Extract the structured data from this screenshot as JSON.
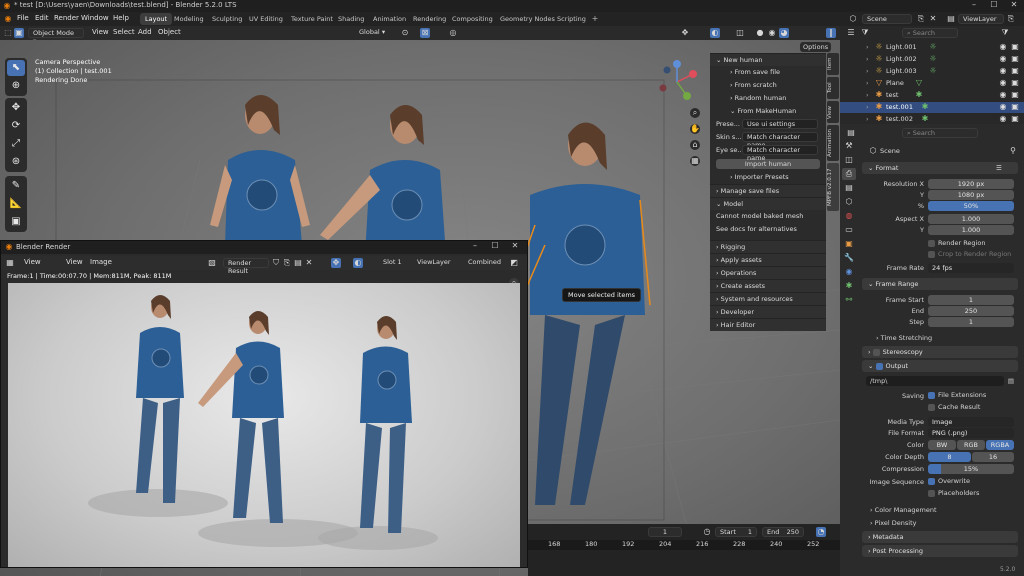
{
  "window": {
    "title": "* test [D:\\Users\\yaen\\Downloads\\test.blend] - Blender 5.2.0 LTS"
  },
  "menu": [
    "File",
    "Edit",
    "Render",
    "Window",
    "Help"
  ],
  "workspaces": [
    "Layout",
    "Modeling",
    "Sculpting",
    "UV Editing",
    "Texture Paint",
    "Shading",
    "Animation",
    "Rendering",
    "Compositing",
    "Geometry Nodes",
    "Scripting"
  ],
  "scene": {
    "label": "Scene",
    "view_layer": "ViewLayer"
  },
  "viewport_header": {
    "mode": "Object Mode",
    "menus": [
      "View",
      "Select",
      "Add",
      "Object"
    ],
    "orientation": "Global",
    "options": "Options"
  },
  "viewport_overlay": {
    "line1": "Camera Perspective",
    "line2": "(1) Collection | test.001",
    "line3": "Rendering Done"
  },
  "tooltip": "Move selected items",
  "npanel": {
    "new_human": "New human",
    "from_save": "From save file",
    "from_scratch": "From scratch",
    "random_human": "Random human",
    "from_makehuman": "From MakeHuman",
    "preset_label": "Prese...",
    "preset_value": "Use ui settings",
    "skin_label": "Skin s...",
    "skin_value": "Match character name",
    "eye_label": "Eye se...",
    "eye_value": "Match character name",
    "import_human": "Import human",
    "importer_presets": "Importer Presets",
    "manage_save": "Manage save files",
    "model": "Model",
    "model_note1": "Cannot model baked mesh",
    "model_note2": "See docs for alternatives",
    "rigging": "Rigging",
    "apply_assets": "Apply assets",
    "operations": "Operations",
    "create_assets": "Create assets",
    "system_resources": "System and resources",
    "developer": "Developer",
    "hair_editor": "Hair Editor"
  },
  "ntabs": [
    "Item",
    "Tool",
    "View",
    "Animation",
    "MPFB v2.0.17"
  ],
  "render_window": {
    "title": "Blender Render",
    "menus": [
      "View",
      "View",
      "Image"
    ],
    "image_name": "Render Result",
    "slot": "Slot 1",
    "view_layer": "ViewLayer",
    "pass": "Combined",
    "stats": "Frame:1 | Time:00:07.70 | Mem:811M, Peak: 811M"
  },
  "outliner": {
    "search_placeholder": "Search",
    "rows": [
      {
        "name": "Light.001",
        "selected": false
      },
      {
        "name": "Light.002",
        "selected": false
      },
      {
        "name": "Light.003",
        "selected": false
      },
      {
        "name": "Plane",
        "selected": false
      },
      {
        "name": "test",
        "selected": false
      },
      {
        "name": "test.001",
        "selected": true
      },
      {
        "name": "test.002",
        "selected": false
      }
    ]
  },
  "properties": {
    "search_placeholder": "Search",
    "scene": "Scene",
    "format": "Format",
    "res_x_label": "Resolution X",
    "res_x": "1920 px",
    "res_y_label": "Y",
    "res_y": "1080 px",
    "res_pct_label": "%",
    "res_pct": "50%",
    "aspect_x_label": "Aspect X",
    "aspect_x": "1.000",
    "aspect_y_label": "Y",
    "aspect_y": "1.000",
    "render_region": "Render Region",
    "crop_region": "Crop to Render Region",
    "frame_rate_label": "Frame Rate",
    "frame_rate": "24 fps",
    "frame_range": "Frame Range",
    "frame_start_label": "Frame Start",
    "frame_start": "1",
    "end_label": "End",
    "end": "250",
    "step_label": "Step",
    "step": "1",
    "time_stretching": "Time Stretching",
    "stereoscopy": "Stereoscopy",
    "output": "Output",
    "path": "/tmp\\",
    "saving_label": "Saving",
    "file_extensions": "File Extensions",
    "cache_result": "Cache Result",
    "media_type_label": "Media Type",
    "media_type": "Image",
    "file_format_label": "File Format",
    "file_format": "PNG (.png)",
    "color_label": "Color",
    "color_opts": [
      "BW",
      "RGB",
      "RGBA"
    ],
    "color_depth_label": "Color Depth",
    "depth_opts": [
      "8",
      "16"
    ],
    "compression_label": "Compression",
    "compression": "15%",
    "image_seq_label": "Image Sequence",
    "overwrite": "Overwrite",
    "placeholders": "Placeholders",
    "color_management": "Color Management",
    "pixel_density": "Pixel Density",
    "metadata": "Metadata",
    "post_processing": "Post Processing"
  },
  "timeline": {
    "current": "1",
    "start_label": "Start",
    "start": "1",
    "end_label": "End",
    "end": "250",
    "ticks": [
      "168",
      "180",
      "192",
      "204",
      "216",
      "228",
      "240",
      "252"
    ]
  },
  "version": "5.2.0"
}
